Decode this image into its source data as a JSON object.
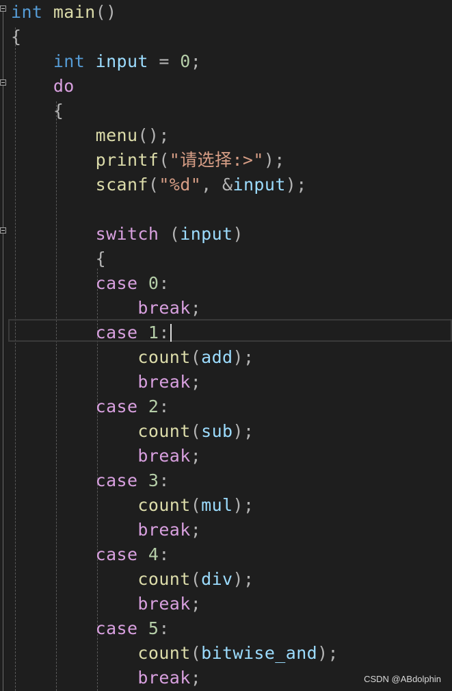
{
  "editor": {
    "lines": [
      {
        "indent": "",
        "tokens": [
          {
            "t": "int",
            "c": "kw"
          },
          {
            "t": " ",
            "c": ""
          },
          {
            "t": "main",
            "c": "fn"
          },
          {
            "t": "()",
            "c": "punc"
          }
        ]
      },
      {
        "indent": "",
        "tokens": [
          {
            "t": "{",
            "c": "punc"
          }
        ]
      },
      {
        "indent": "    ",
        "tokens": [
          {
            "t": "int",
            "c": "kw"
          },
          {
            "t": " ",
            "c": ""
          },
          {
            "t": "input",
            "c": "var"
          },
          {
            "t": " = ",
            "c": "punc"
          },
          {
            "t": "0",
            "c": "num"
          },
          {
            "t": ";",
            "c": "punc"
          }
        ]
      },
      {
        "indent": "    ",
        "tokens": [
          {
            "t": "do",
            "c": "ctrl"
          }
        ]
      },
      {
        "indent": "    ",
        "tokens": [
          {
            "t": "{",
            "c": "punc"
          }
        ]
      },
      {
        "indent": "        ",
        "tokens": [
          {
            "t": "menu",
            "c": "fn"
          },
          {
            "t": "();",
            "c": "punc"
          }
        ]
      },
      {
        "indent": "        ",
        "tokens": [
          {
            "t": "printf",
            "c": "fn"
          },
          {
            "t": "(",
            "c": "punc"
          },
          {
            "t": "\"请选择:>\"",
            "c": "str"
          },
          {
            "t": ");",
            "c": "punc"
          }
        ]
      },
      {
        "indent": "        ",
        "tokens": [
          {
            "t": "scanf",
            "c": "fn"
          },
          {
            "t": "(",
            "c": "punc"
          },
          {
            "t": "\"%d\"",
            "c": "str"
          },
          {
            "t": ", &",
            "c": "punc"
          },
          {
            "t": "input",
            "c": "var"
          },
          {
            "t": ");",
            "c": "punc"
          }
        ]
      },
      {
        "indent": "",
        "tokens": []
      },
      {
        "indent": "        ",
        "tokens": [
          {
            "t": "switch",
            "c": "ctrl"
          },
          {
            "t": " (",
            "c": "punc"
          },
          {
            "t": "input",
            "c": "var"
          },
          {
            "t": ")",
            "c": "punc"
          }
        ]
      },
      {
        "indent": "        ",
        "tokens": [
          {
            "t": "{",
            "c": "punc"
          }
        ]
      },
      {
        "indent": "        ",
        "tokens": [
          {
            "t": "case",
            "c": "ctrl"
          },
          {
            "t": " ",
            "c": ""
          },
          {
            "t": "0",
            "c": "num"
          },
          {
            "t": ":",
            "c": "punc"
          }
        ]
      },
      {
        "indent": "            ",
        "tokens": [
          {
            "t": "break",
            "c": "ctrl"
          },
          {
            "t": ";",
            "c": "punc"
          }
        ]
      },
      {
        "indent": "        ",
        "tokens": [
          {
            "t": "case",
            "c": "ctrl"
          },
          {
            "t": " ",
            "c": ""
          },
          {
            "t": "1",
            "c": "num"
          },
          {
            "t": ":",
            "c": "punc"
          }
        ],
        "caret": true
      },
      {
        "indent": "            ",
        "tokens": [
          {
            "t": "count",
            "c": "fn"
          },
          {
            "t": "(",
            "c": "punc"
          },
          {
            "t": "add",
            "c": "var"
          },
          {
            "t": ");",
            "c": "punc"
          }
        ]
      },
      {
        "indent": "            ",
        "tokens": [
          {
            "t": "break",
            "c": "ctrl"
          },
          {
            "t": ";",
            "c": "punc"
          }
        ]
      },
      {
        "indent": "        ",
        "tokens": [
          {
            "t": "case",
            "c": "ctrl"
          },
          {
            "t": " ",
            "c": ""
          },
          {
            "t": "2",
            "c": "num"
          },
          {
            "t": ":",
            "c": "punc"
          }
        ]
      },
      {
        "indent": "            ",
        "tokens": [
          {
            "t": "count",
            "c": "fn"
          },
          {
            "t": "(",
            "c": "punc"
          },
          {
            "t": "sub",
            "c": "var"
          },
          {
            "t": ");",
            "c": "punc"
          }
        ]
      },
      {
        "indent": "            ",
        "tokens": [
          {
            "t": "break",
            "c": "ctrl"
          },
          {
            "t": ";",
            "c": "punc"
          }
        ]
      },
      {
        "indent": "        ",
        "tokens": [
          {
            "t": "case",
            "c": "ctrl"
          },
          {
            "t": " ",
            "c": ""
          },
          {
            "t": "3",
            "c": "num"
          },
          {
            "t": ":",
            "c": "punc"
          }
        ]
      },
      {
        "indent": "            ",
        "tokens": [
          {
            "t": "count",
            "c": "fn"
          },
          {
            "t": "(",
            "c": "punc"
          },
          {
            "t": "mul",
            "c": "var"
          },
          {
            "t": ");",
            "c": "punc"
          }
        ]
      },
      {
        "indent": "            ",
        "tokens": [
          {
            "t": "break",
            "c": "ctrl"
          },
          {
            "t": ";",
            "c": "punc"
          }
        ]
      },
      {
        "indent": "        ",
        "tokens": [
          {
            "t": "case",
            "c": "ctrl"
          },
          {
            "t": " ",
            "c": ""
          },
          {
            "t": "4",
            "c": "num"
          },
          {
            "t": ":",
            "c": "punc"
          }
        ]
      },
      {
        "indent": "            ",
        "tokens": [
          {
            "t": "count",
            "c": "fn"
          },
          {
            "t": "(",
            "c": "punc"
          },
          {
            "t": "div",
            "c": "var"
          },
          {
            "t": ");",
            "c": "punc"
          }
        ]
      },
      {
        "indent": "            ",
        "tokens": [
          {
            "t": "break",
            "c": "ctrl"
          },
          {
            "t": ";",
            "c": "punc"
          }
        ]
      },
      {
        "indent": "        ",
        "tokens": [
          {
            "t": "case",
            "c": "ctrl"
          },
          {
            "t": " ",
            "c": ""
          },
          {
            "t": "5",
            "c": "num"
          },
          {
            "t": ":",
            "c": "punc"
          }
        ]
      },
      {
        "indent": "            ",
        "tokens": [
          {
            "t": "count",
            "c": "fn"
          },
          {
            "t": "(",
            "c": "punc"
          },
          {
            "t": "bitwise_and",
            "c": "var"
          },
          {
            "t": ");",
            "c": "punc"
          }
        ]
      },
      {
        "indent": "            ",
        "tokens": [
          {
            "t": "break",
            "c": "ctrl"
          },
          {
            "t": ";",
            "c": "punc"
          }
        ]
      }
    ],
    "fold_markers": [
      {
        "icon": "collapse-icon",
        "line": 0
      },
      {
        "icon": "collapse-icon",
        "line": 3
      },
      {
        "icon": "collapse-icon",
        "line": 9
      }
    ],
    "colors": {
      "background": "#1e1e1e",
      "keyword": "#569cd6",
      "control": "#d8a0df",
      "function": "#dcdcaa",
      "variable": "#9cdcfe",
      "number": "#b5cea8",
      "string": "#d69d85",
      "punctuation": "#b4b4b4"
    }
  },
  "watermark": {
    "text": "CSDN @ABdolphin"
  }
}
